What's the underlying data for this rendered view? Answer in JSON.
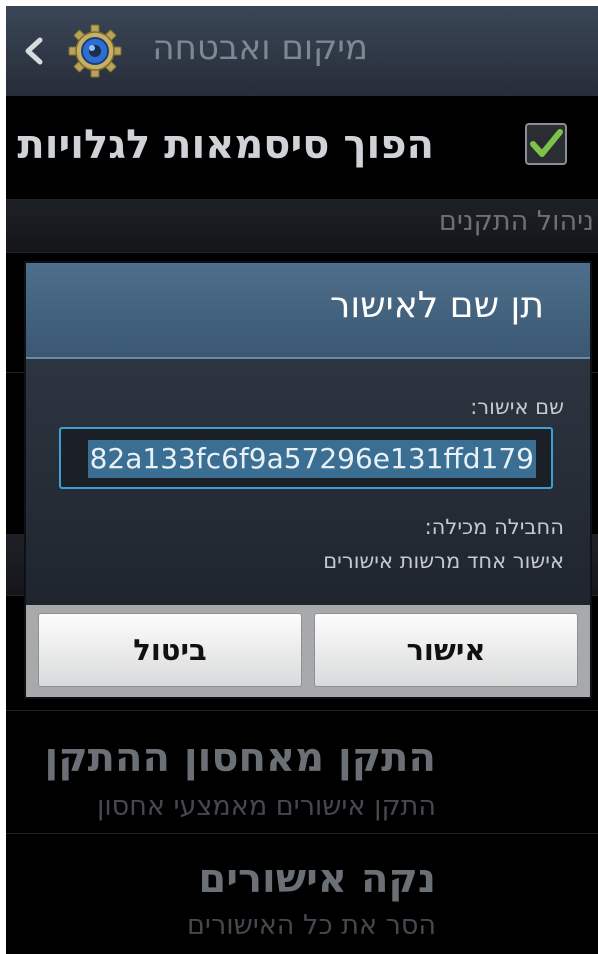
{
  "header": {
    "title": "מיקום ואבטחה",
    "back_icon": "chevron-left-icon",
    "app_icon": "gear-icon"
  },
  "settings": {
    "visible_passwords": {
      "label": "הפוך סיסמאות לגלויות",
      "checked": true
    },
    "section_device_admin": "ניהול התקנים",
    "install_from_storage": {
      "title": "התקן מאחסון ההתקן",
      "subtitle": "התקן אישורים מאמצעי אחסון"
    },
    "clear_credentials": {
      "title": "נקה אישורים",
      "subtitle": "הסר את כל האישורים"
    }
  },
  "dialog": {
    "title": "תן שם לאישור",
    "name_label": "שם אישור:",
    "name_value": "82a133fc6f9a57296e131ffd179",
    "bundle_label": "החבילה מכילה:",
    "bundle_value": "אישור אחד מרשות אישורים",
    "ok_label": "אישור",
    "cancel_label": "ביטול"
  },
  "colors": {
    "accent": "#3e9fd6",
    "checkbox_green": "#7ec24a",
    "dialog_header": "#4e6e8b"
  }
}
